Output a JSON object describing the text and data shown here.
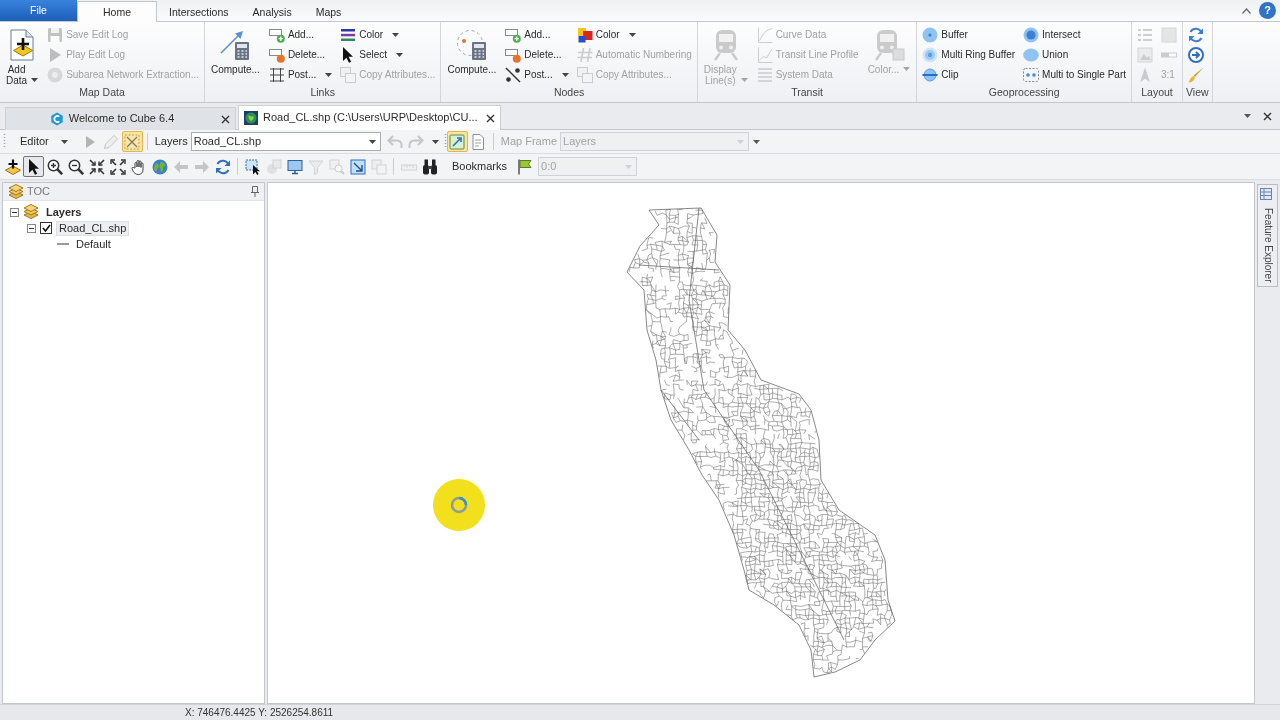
{
  "title_bar": {
    "help_label": "?"
  },
  "ribbon": {
    "tabs": [
      {
        "label": "File",
        "kind": "file",
        "selected": false
      },
      {
        "label": "Home",
        "kind": "tab",
        "selected": true
      },
      {
        "label": "Intersections",
        "kind": "tab",
        "selected": false
      },
      {
        "label": "Analysis",
        "kind": "tab",
        "selected": false
      },
      {
        "label": "Maps",
        "kind": "tab",
        "selected": false
      }
    ],
    "groups": [
      {
        "title": "Map Data",
        "columns": [
          [
            {
              "label": "Add Data",
              "kind": "large",
              "dropdown": true,
              "disabled": false
            }
          ],
          [
            {
              "label": "Save Edit Log",
              "kind": "small",
              "dropdown": false,
              "disabled": true
            },
            {
              "label": "Play Edit Log",
              "kind": "small",
              "dropdown": false,
              "disabled": true
            },
            {
              "label": "Subarea Network Extraction...",
              "kind": "small",
              "dropdown": false,
              "disabled": true
            }
          ]
        ]
      },
      {
        "title": "Links",
        "columns": [
          [
            {
              "label": "Compute...",
              "kind": "large",
              "dropdown": false,
              "disabled": false
            }
          ],
          [
            {
              "label": "Add...",
              "kind": "small",
              "dropdown": false,
              "disabled": false
            },
            {
              "label": "Delete...",
              "kind": "small",
              "dropdown": false,
              "disabled": false
            },
            {
              "label": "Post...",
              "kind": "small",
              "dropdown": true,
              "disabled": false
            }
          ],
          [
            {
              "label": "Color",
              "kind": "small",
              "dropdown": true,
              "disabled": false
            },
            {
              "label": "Select",
              "kind": "small",
              "dropdown": true,
              "disabled": false
            },
            {
              "label": "Copy Attributes...",
              "kind": "small",
              "dropdown": false,
              "disabled": true
            }
          ]
        ]
      },
      {
        "title": "Nodes",
        "columns": [
          [
            {
              "label": "Compute...",
              "kind": "large",
              "dropdown": false,
              "disabled": false
            }
          ],
          [
            {
              "label": "Add...",
              "kind": "small",
              "dropdown": false,
              "disabled": false
            },
            {
              "label": "Delete...",
              "kind": "small",
              "dropdown": false,
              "disabled": false
            },
            {
              "label": "Post...",
              "kind": "small",
              "dropdown": true,
              "disabled": false
            }
          ],
          [
            {
              "label": "Color",
              "kind": "small",
              "dropdown": true,
              "disabled": false
            },
            {
              "label": "Automatic Numbering",
              "kind": "small",
              "dropdown": false,
              "disabled": true
            },
            {
              "label": "Copy Attributes...",
              "kind": "small",
              "dropdown": false,
              "disabled": true
            }
          ]
        ]
      },
      {
        "title": "Transit",
        "columns": [
          [
            {
              "label": "Display Line(s)",
              "kind": "large",
              "dropdown": true,
              "disabled": true
            }
          ],
          [
            {
              "label": "Curve Data",
              "kind": "small",
              "dropdown": false,
              "disabled": true
            },
            {
              "label": "Transit Line Profile",
              "kind": "small",
              "dropdown": false,
              "disabled": true
            },
            {
              "label": "System Data",
              "kind": "small",
              "dropdown": false,
              "disabled": true
            }
          ],
          [
            {
              "label": "Color...",
              "kind": "large",
              "dropdown": true,
              "disabled": true
            }
          ]
        ]
      },
      {
        "title": "Geoprocessing",
        "columns": [
          [
            {
              "label": "Buffer",
              "kind": "small",
              "dropdown": false,
              "disabled": false
            },
            {
              "label": "Multi Ring Buffer",
              "kind": "small",
              "dropdown": false,
              "disabled": false
            },
            {
              "label": "Clip",
              "kind": "small",
              "dropdown": false,
              "disabled": false
            }
          ],
          [
            {
              "label": "Intersect",
              "kind": "small",
              "dropdown": false,
              "disabled": false
            },
            {
              "label": "Union",
              "kind": "small",
              "dropdown": false,
              "disabled": false
            },
            {
              "label": "Multi to Single Part",
              "kind": "small",
              "dropdown": false,
              "disabled": false
            }
          ]
        ]
      },
      {
        "title": "Layout",
        "columns": [
          [
            {
              "kind": "icon",
              "disabled": true
            },
            {
              "kind": "icon",
              "disabled": true
            },
            {
              "kind": "icon",
              "disabled": true
            }
          ],
          [
            {
              "kind": "icon",
              "disabled": true
            },
            {
              "kind": "icon",
              "disabled": true
            },
            {
              "label": "3:1",
              "kind": "small",
              "dropdown": false,
              "disabled": true
            }
          ]
        ]
      },
      {
        "title": "View",
        "columns": [
          [
            {
              "kind": "icon",
              "disabled": false
            },
            {
              "kind": "icon",
              "disabled": false
            },
            {
              "kind": "icon",
              "disabled": false
            }
          ]
        ]
      }
    ]
  },
  "documents": {
    "tabs": [
      {
        "label": "Welcome to Cube 6.4",
        "selected": false
      },
      {
        "label": "Road_CL.shp (C:\\Users\\URP\\Desktop\\CU...",
        "selected": true
      }
    ]
  },
  "editor_toolbar": {
    "menu": "Editor",
    "tools": [
      {
        "disabled": true,
        "selected": false
      },
      {
        "disabled": true,
        "selected": false
      },
      {
        "disabled": false,
        "selected": true
      }
    ],
    "layer_label": "Layers",
    "layer_value": "Road_CL.shp",
    "history": [
      {
        "disabled": true
      },
      {
        "disabled": true
      }
    ],
    "view_tools": [
      {
        "disabled": false,
        "selected": true
      },
      {
        "disabled": false,
        "selected": false
      }
    ],
    "map_frame": {
      "label": "Map Frame",
      "value": "Layers",
      "disabled": true
    }
  },
  "map_toolbar": {
    "tool_groups": [
      [
        {
          "disabled": false,
          "selected": false
        },
        {
          "disabled": false,
          "selected": true
        },
        {
          "disabled": false,
          "selected": false
        },
        {
          "disabled": false,
          "selected": false
        },
        {
          "disabled": false,
          "selected": false
        },
        {
          "disabled": false,
          "selected": false
        },
        {
          "disabled": false,
          "selected": false
        },
        {
          "disabled": false,
          "selected": false
        },
        {
          "disabled": true,
          "selected": false
        },
        {
          "disabled": true,
          "selected": false
        },
        {
          "disabled": false,
          "selected": false
        }
      ],
      [
        {
          "disabled": false,
          "selected": false
        },
        {
          "disabled": true,
          "selected": false
        },
        {
          "disabled": false,
          "selected": false
        },
        {
          "disabled": true,
          "selected": false
        },
        {
          "disabled": true,
          "selected": false
        },
        {
          "disabled": false,
          "selected": false
        },
        {
          "disabled": true,
          "selected": false
        }
      ],
      [
        {
          "disabled": true,
          "selected": false
        },
        {
          "disabled": false,
          "selected": false
        }
      ]
    ],
    "bookmarks": "Bookmarks",
    "bookmark_tools": [
      {
        "disabled": false,
        "selected": false
      }
    ],
    "scale": {
      "value": "0:0",
      "disabled": true
    }
  },
  "toc": {
    "title": "TOC",
    "tree": [
      {
        "label": "Layers",
        "kind": "group",
        "expanded": true,
        "selected": false,
        "children": [
          {
            "label": "Road_CL.shp",
            "kind": "layer",
            "expanded": true,
            "checked": true,
            "selected": true,
            "children": [
              {
                "label": "Default",
                "kind": "legend",
                "selected": false
              }
            ]
          }
        ]
      }
    ]
  },
  "side_tabs": [
    {
      "label": "Feature Explorer"
    }
  ],
  "status_bar": {
    "coordinates": "X: 746476.4425 Y: 2526254.8611"
  }
}
